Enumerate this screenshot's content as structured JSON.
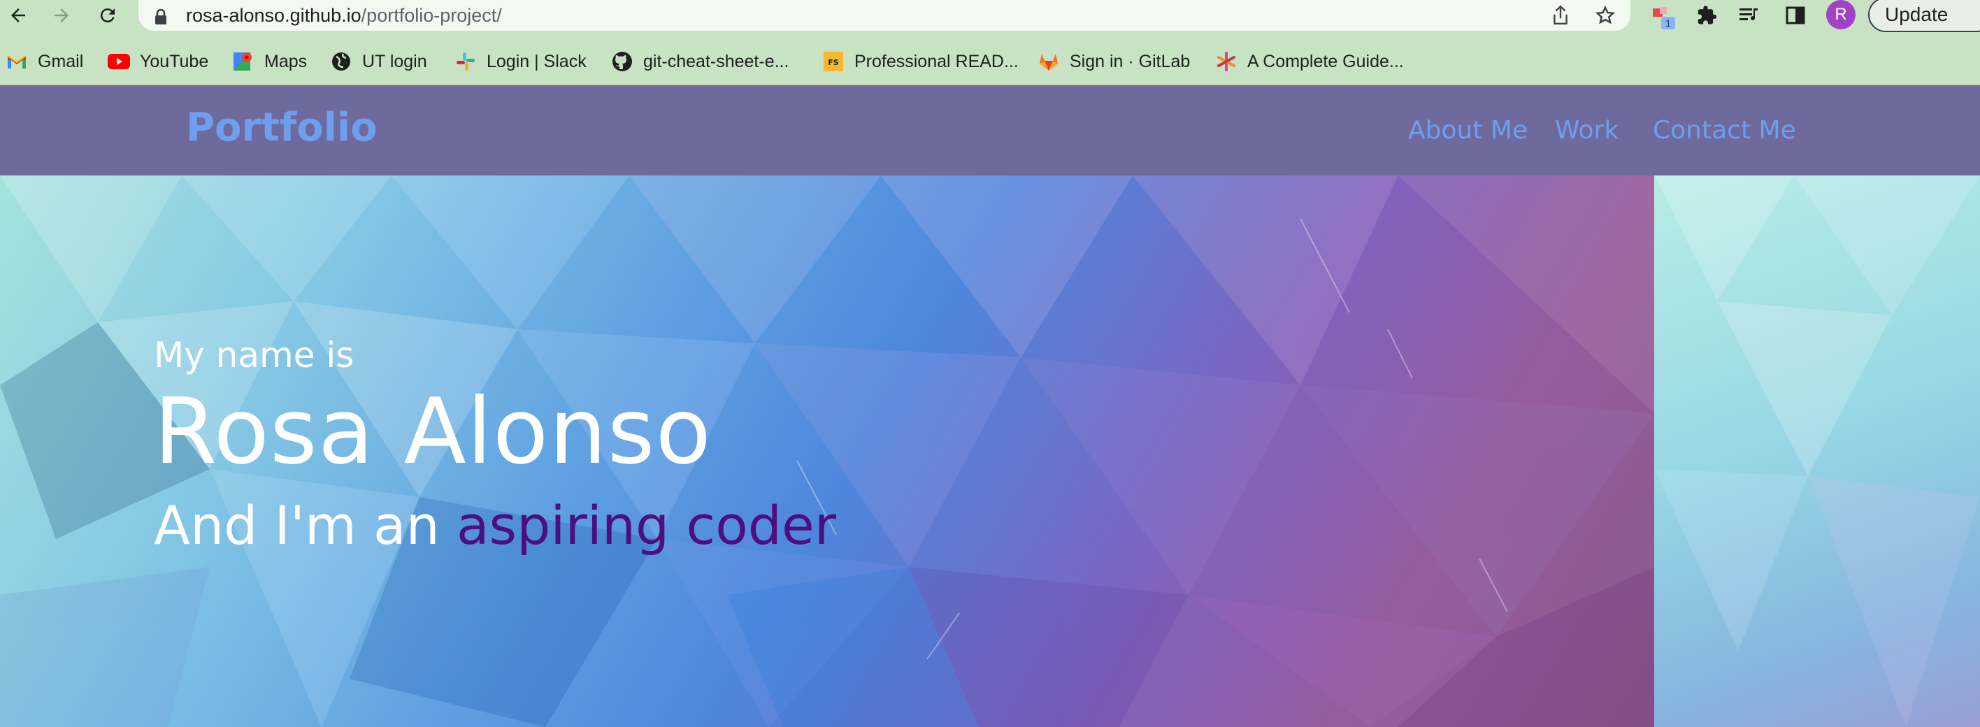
{
  "browser": {
    "url_host": "rosa-alonso.github.io",
    "url_path": "/portfolio-project/",
    "extension_badge": "1",
    "profile_initial": "R",
    "update_label": "Update",
    "icons": [
      "back-icon",
      "forward-icon",
      "reload-icon",
      "lock-icon",
      "share-icon",
      "star-icon",
      "extension-icon",
      "puzzle-icon",
      "reading-list-icon",
      "side-panel-icon"
    ]
  },
  "bookmarks": [
    {
      "label": "Gmail",
      "icon": "gmail-icon"
    },
    {
      "label": "YouTube",
      "icon": "youtube-icon"
    },
    {
      "label": "Maps",
      "icon": "maps-icon"
    },
    {
      "label": "UT login",
      "icon": "globe-icon"
    },
    {
      "label": "Login | Slack",
      "icon": "slack-icon"
    },
    {
      "label": "git-cheat-sheet-e...",
      "icon": "github-icon"
    },
    {
      "label": "Professional READ...",
      "icon": "fs-icon"
    },
    {
      "label": "Sign in · GitLab",
      "icon": "gitlab-icon"
    },
    {
      "label": "A Complete Guide...",
      "icon": "asterisk-icon"
    }
  ],
  "site": {
    "brand": "Portfolio",
    "nav": [
      "About Me",
      "Work",
      "Contact Me"
    ],
    "hero": {
      "intro": "My name is",
      "name": "Rosa Alonso",
      "tagline_prefix": "And I'm an ",
      "tagline_accent": "aspiring coder"
    },
    "colors": {
      "nav_bg": "#6e6a9e",
      "link": "#6d9fee",
      "accent_text": "#4d0f7f"
    }
  }
}
